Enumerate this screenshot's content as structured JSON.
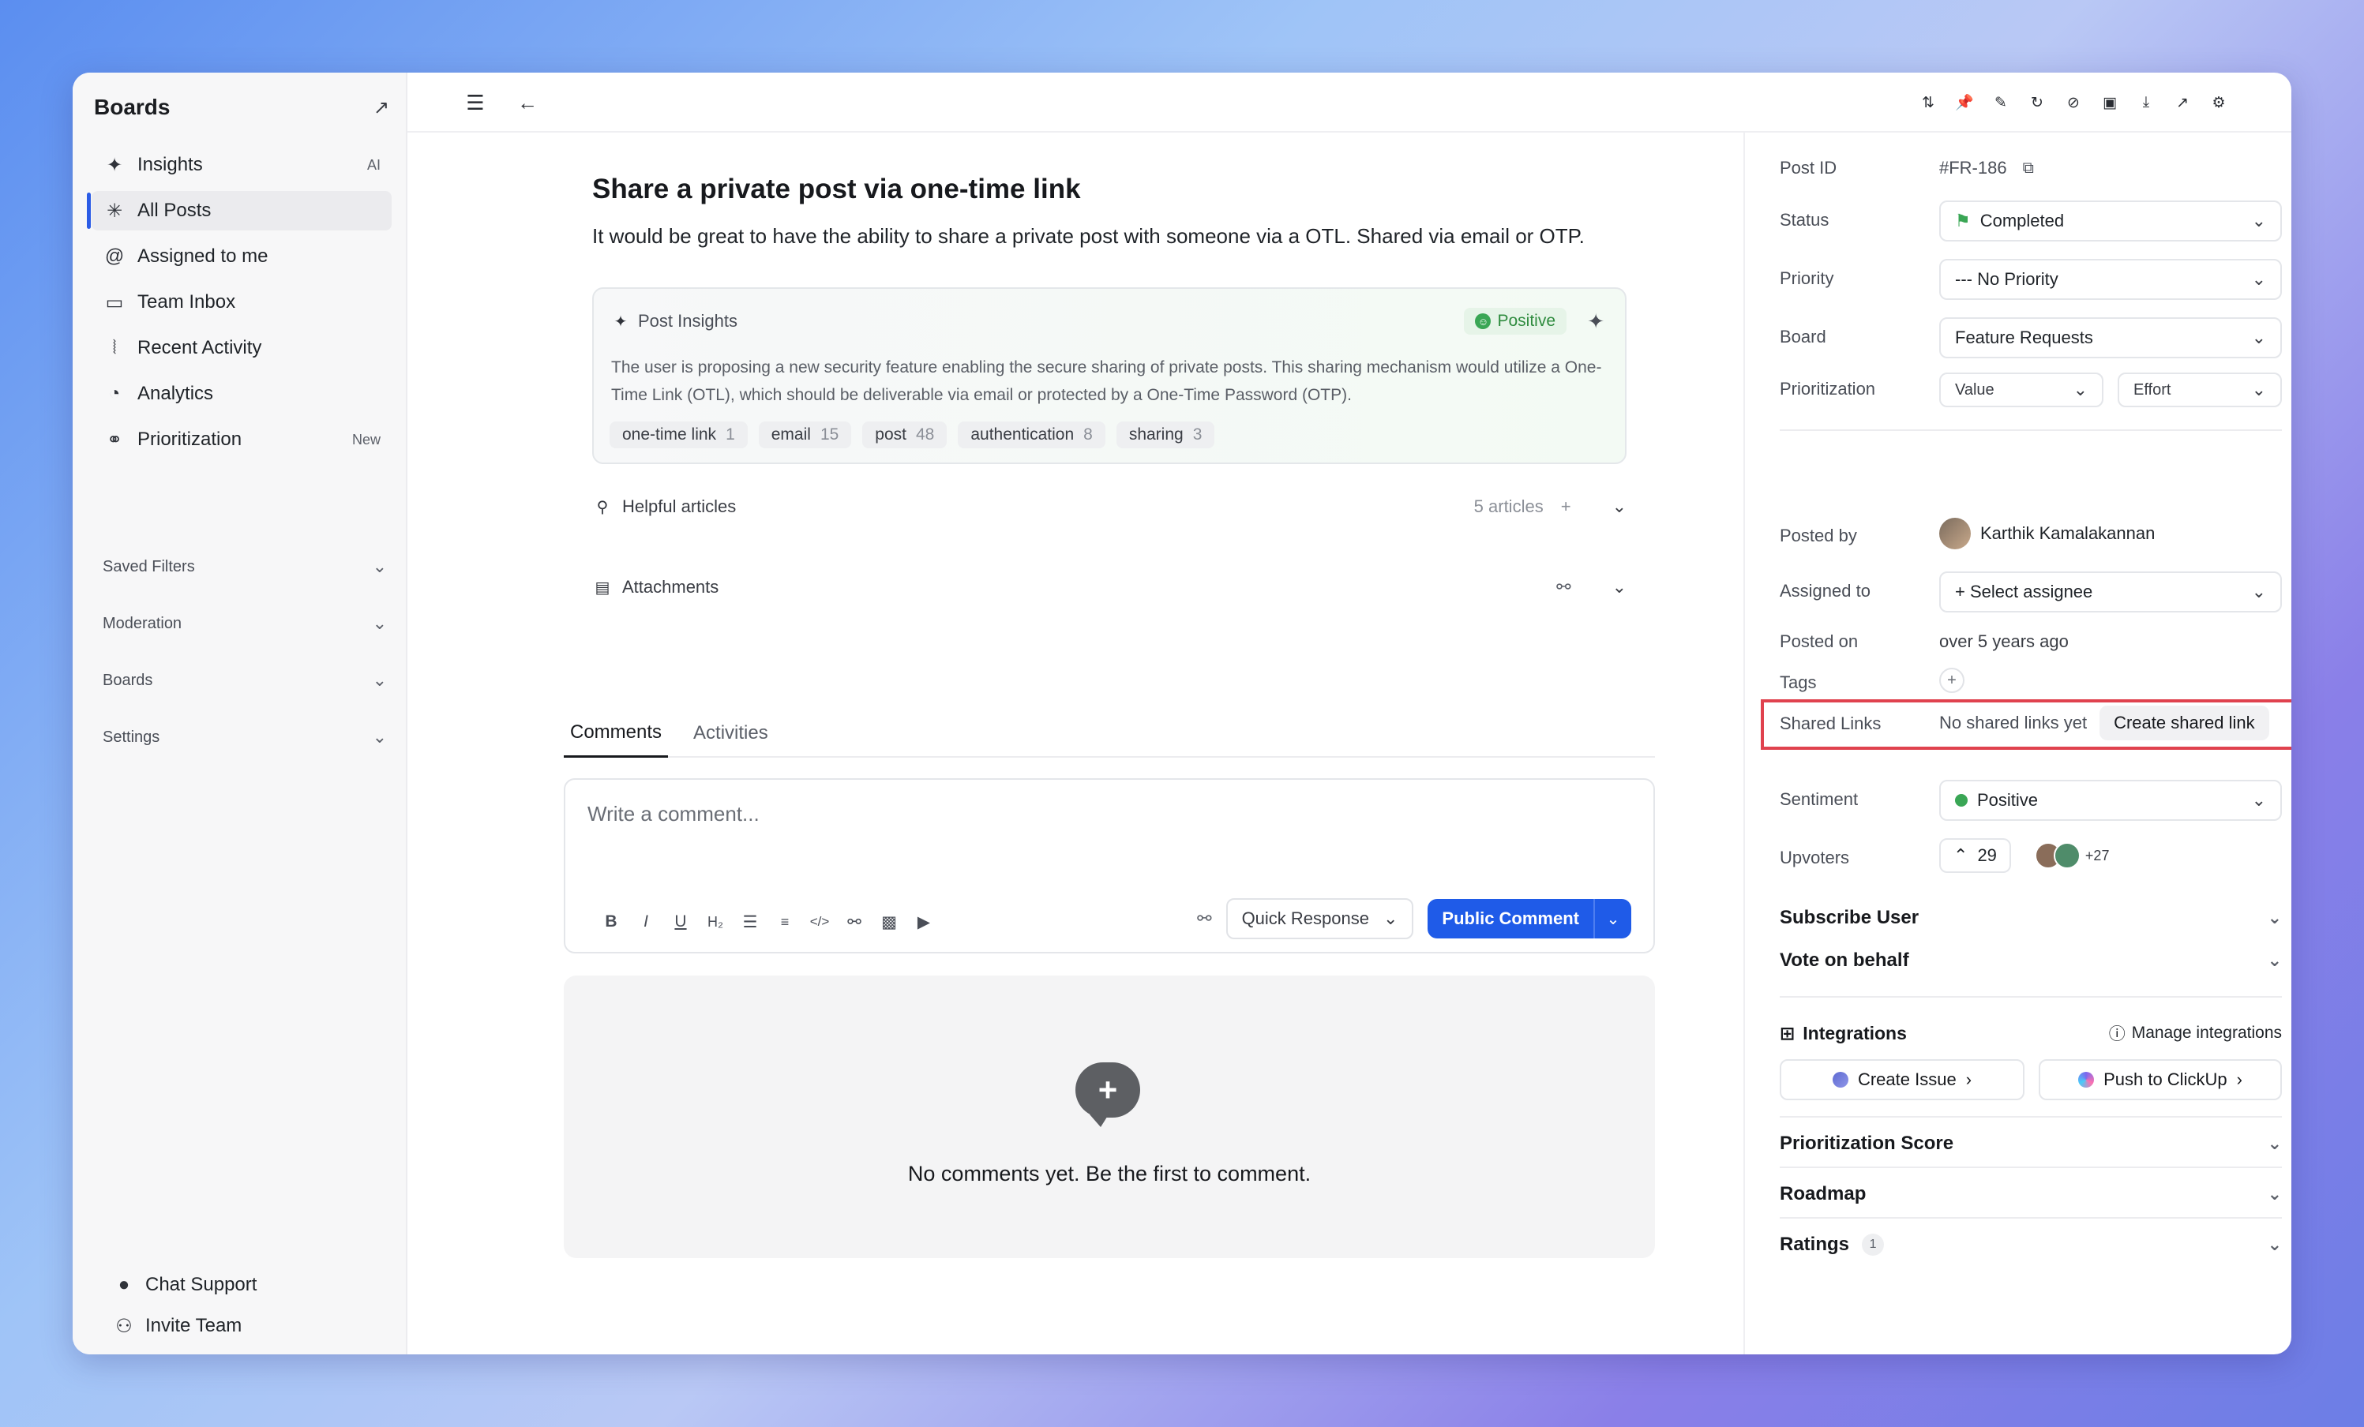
{
  "sidebar": {
    "title": "Boards",
    "nav": [
      {
        "label": "Insights",
        "badge": "AI",
        "icon": "sparkle-icon",
        "glyph": "✦"
      },
      {
        "label": "All Posts",
        "badge": "",
        "icon": "asterisk-icon",
        "glyph": "✳"
      },
      {
        "label": "Assigned to me",
        "badge": "",
        "icon": "at-icon",
        "glyph": "@"
      },
      {
        "label": "Team Inbox",
        "badge": "",
        "icon": "inbox-icon",
        "glyph": "▭"
      },
      {
        "label": "Recent Activity",
        "badge": "",
        "icon": "rss-icon",
        "glyph": "⦚"
      },
      {
        "label": "Analytics",
        "badge": "",
        "icon": "gauge-icon",
        "glyph": "◔"
      },
      {
        "label": "Prioritization",
        "badge": "New",
        "icon": "binoculars-icon",
        "glyph": "⚭"
      }
    ],
    "sections": [
      "Saved Filters",
      "Moderation",
      "Boards",
      "Settings"
    ],
    "bottom": [
      {
        "label": "Chat Support",
        "icon": "chat-icon",
        "glyph": "●"
      },
      {
        "label": "Invite Team",
        "icon": "user-plus-icon",
        "glyph": "👤"
      }
    ]
  },
  "post": {
    "title": "Share a private post via one-time link",
    "description": "It would be great to have the ability to share a private post with someone via a OTL. Shared via email or OTP.",
    "insights": {
      "heading": "Post Insights",
      "sentiment": "Positive",
      "text": "The user is proposing a new security feature enabling the secure sharing of private posts. This sharing mechanism would utilize a One-Time Link (OTL), which should be deliverable via email or protected by a One-Time Password (OTP).",
      "chips": [
        {
          "label": "one-time link",
          "count": "1"
        },
        {
          "label": "email",
          "count": "15"
        },
        {
          "label": "post",
          "count": "48"
        },
        {
          "label": "authentication",
          "count": "8"
        },
        {
          "label": "sharing",
          "count": "3"
        }
      ]
    },
    "helpful_articles": {
      "label": "Helpful articles",
      "count": "5 articles"
    },
    "attachments": {
      "label": "Attachments"
    }
  },
  "tabs": [
    "Comments",
    "Activities"
  ],
  "composer": {
    "placeholder": "Write a comment...",
    "quick_response": "Quick Response",
    "public_comment": "Public Comment"
  },
  "empty": {
    "text": "No comments yet. Be the first to comment."
  },
  "details": {
    "post_id_label": "Post ID",
    "post_id": "#FR-186",
    "status_label": "Status",
    "status": "Completed",
    "priority_label": "Priority",
    "priority": "--- No Priority",
    "board_label": "Board",
    "board": "Feature Requests",
    "prioritization_label": "Prioritization",
    "value": "Value",
    "effort": "Effort",
    "posted_by_label": "Posted by",
    "posted_by": "Karthik Kamalakannan",
    "assigned_label": "Assigned to",
    "assigned": "+ Select assignee",
    "posted_on_label": "Posted on",
    "posted_on": "over 5 years ago",
    "tags_label": "Tags",
    "shared_links_label": "Shared Links",
    "shared_links_empty": "No shared links yet",
    "create_shared_link": "Create shared link",
    "sentiment_label": "Sentiment",
    "sentiment": "Positive",
    "upvoters_label": "Upvoters",
    "upvotes": "29",
    "upvoters_more": "+27",
    "subscribe_user": "Subscribe User",
    "vote_on_behalf": "Vote on behalf",
    "integrations": "Integrations",
    "manage_integrations": "Manage integrations",
    "create_issue": "Create Issue",
    "push_clickup": "Push to ClickUp",
    "prioritization_score": "Prioritization Score",
    "roadmap": "Roadmap",
    "ratings": "Ratings",
    "ratings_count": "1"
  },
  "colors": {
    "accent": "#1f5be8",
    "positive": "#3aa655",
    "highlight": "#e0424e"
  }
}
